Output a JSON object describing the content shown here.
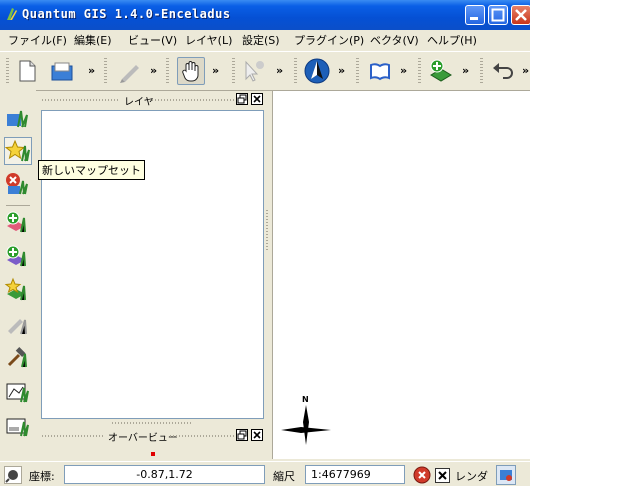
{
  "window": {
    "title": "Quantum GIS 1.4.0-Enceladus"
  },
  "menu": [
    "ファイル(F)",
    "編集(E)",
    "ビュー(V)",
    "レイヤ(L)",
    "設定(S)",
    "プラグイン(P)",
    "ベクタ(V)",
    "ヘルプ(H)"
  ],
  "toolbar": {
    "extension_label": "»"
  },
  "tooltip": {
    "text": "新しいマップセット"
  },
  "layers_panel": {
    "title": "レイヤ"
  },
  "overview_panel": {
    "title": "オーバービュー"
  },
  "map": {
    "north_label": "N"
  },
  "status": {
    "coord_label": "座標:",
    "coord_value": "-0.87,1.72",
    "scale_label": "縮尺",
    "scale_value": "1:4677969",
    "render_label": "レンダ"
  },
  "colors": {
    "title_bar": "#0a5fe6",
    "face": "#ece9d8",
    "tooltip_bg": "#ffffe1",
    "close_button": "#c8351a"
  },
  "icons": [
    "qgis-icon",
    "minimize-icon",
    "maximize-icon",
    "close-icon",
    "new-project-icon",
    "open-project-icon",
    "digitize-pencil-icon",
    "pan-hand-icon",
    "identify-icon",
    "north-arrow-icon",
    "book-icon",
    "add-layer-icon",
    "undo-icon"
  ]
}
